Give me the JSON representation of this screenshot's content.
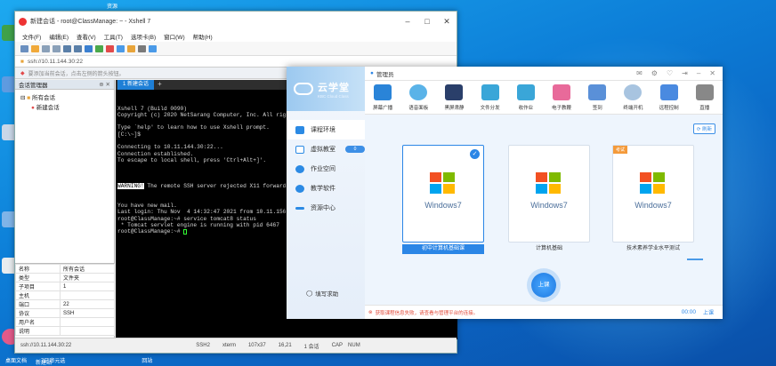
{
  "desktop": {
    "top_label": "资源",
    "bottom_items": [
      "桌面文档",
      "7日审元选",
      "回站"
    ],
    "bottom_sub": "新建站"
  },
  "xshell": {
    "title": "新建会话 - root@ClassManage: ~ - Xshell 7",
    "menu": [
      "文件(F)",
      "编辑(E)",
      "查看(V)",
      "工具(T)",
      "选项卡(B)",
      "窗口(W)",
      "帮助(H)"
    ],
    "address": "ssh://10.11.144.30:22",
    "hint": "要添加当前会话，点击左侧的箭头按钮。",
    "session_panel_title": "会话管理器",
    "tree": {
      "root": "所有会话",
      "child": "新建会话"
    },
    "tab_label": "1 新建会话",
    "terminal_lines": [
      "Xshell 7 (Build 0090)",
      "Copyright (c) 2020 NetSarang Computer, Inc. All rights",
      "",
      "Type `help' to learn how to use Xshell prompt.",
      "[C:\\~]$",
      "",
      "Connecting to 10.11.144.30:22...",
      "Connection established.",
      "To escape to local shell, press 'Ctrl+Alt+]'.",
      ""
    ],
    "warning_tag": "WARNING!",
    "warning_rest": " The remote SSH server rejected X11 forwarding",
    "terminal_lines2": [
      "You have new mail.",
      "Last login: Thu Nov  4 14:32:47 2021 from 10.11.156.253",
      "root@ClassManage:~# service tomcat8 status",
      " * Tomcat servlet engine is running with pid 6467",
      "root@ClassManage:~# "
    ],
    "props": [
      [
        "名称",
        "所有会话"
      ],
      [
        "类型",
        "文件夹"
      ],
      [
        "子项目",
        "1"
      ],
      [
        "主机",
        ""
      ],
      [
        "端口",
        "22"
      ],
      [
        "协议",
        "SSH"
      ],
      [
        "用户名",
        ""
      ],
      [
        "说明",
        ""
      ]
    ],
    "status": {
      "addr": "ssh://10.11.144.30:22",
      "proto": "SSH2",
      "term": "xterm",
      "size": "107x37",
      "pos": "16,21",
      "sessions": "1 会话",
      "caps": "CAP",
      "num": "NUM"
    }
  },
  "cloudclass": {
    "logo_title": "云学堂",
    "logo_sub": "KBC Cloud Class",
    "user": "管理员",
    "nav": [
      "课程环境",
      "虚拟教室",
      "作业空间",
      "教学软件",
      "资源中心"
    ],
    "nav_pill": "0",
    "feedback": "填写求助",
    "tools": [
      "屏幕广播",
      "语音面板",
      "黑屏肃静",
      "文件分发",
      "收作业",
      "电子教鞭",
      "签到",
      "终端开机",
      "远程控制",
      "直播"
    ],
    "refresh": "刷新",
    "cards": [
      {
        "logo": "Windows7",
        "label": "初中计算机基础课",
        "selected": true,
        "badge": ""
      },
      {
        "logo": "Windows7",
        "label": "计算机基础",
        "selected": false,
        "badge": ""
      },
      {
        "logo": "Windows7",
        "label": "技术素养学业水平测试",
        "selected": false,
        "badge": "考试"
      }
    ],
    "start_button": "上课",
    "error": "获取课程信息失败，请查看与管理平台的连接。",
    "timer": "00:00",
    "end": "上课"
  },
  "colors": {
    "accent": "#2b86e6",
    "error": "#e24b3b",
    "terminal_bg": "#000000"
  }
}
